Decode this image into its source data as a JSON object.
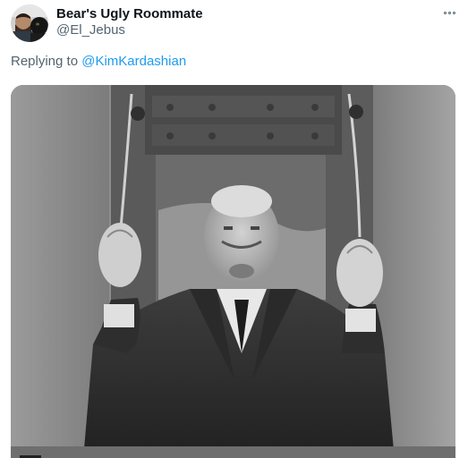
{
  "tweet": {
    "display_name": "Bear's Ugly Roommate",
    "handle": "@El_Jebus",
    "more_icon": "more-horizontal-icon",
    "replying_prefix": "Replying to",
    "replying_to": "@KimKardashian",
    "link_color": "#1d9bf0",
    "media": {
      "kind": "animated-gif",
      "tone": "black-and-white"
    }
  }
}
